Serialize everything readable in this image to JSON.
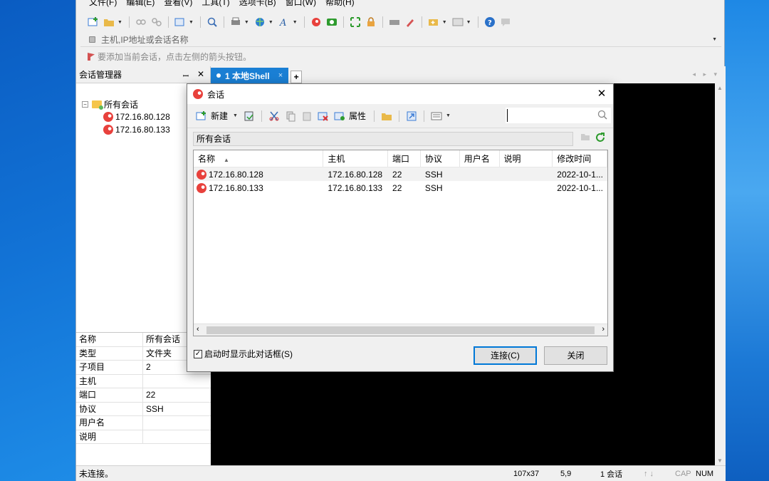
{
  "menu": [
    "文件(F)",
    "编辑(E)",
    "查看(V)",
    "工具(T)",
    "选项卡(B)",
    "窗口(W)",
    "帮助(H)"
  ],
  "address": {
    "placeholder": "主机,IP地址或会话名称"
  },
  "hint": "要添加当前会话，点击左侧的箭头按钮。",
  "session_manager": {
    "title": "会话管理器",
    "tree_root": "所有会话",
    "sessions": [
      "172.16.80.128",
      "172.16.80.133"
    ]
  },
  "properties": [
    {
      "k": "名称",
      "v": "所有会话"
    },
    {
      "k": "类型",
      "v": "文件夹"
    },
    {
      "k": "子项目",
      "v": "2"
    },
    {
      "k": "主机",
      "v": ""
    },
    {
      "k": "端口",
      "v": "22"
    },
    {
      "k": "协议",
      "v": "SSH"
    },
    {
      "k": "用户名",
      "v": ""
    },
    {
      "k": "说明",
      "v": ""
    }
  ],
  "tab": {
    "label": "1 本地Shell",
    "close": "×",
    "add": "+"
  },
  "status": {
    "left": "未连接。",
    "size": "107x37",
    "pos": "5,9",
    "sessions": "1 会话",
    "cap": "CAP",
    "num": "NUM"
  },
  "dialog": {
    "title": "会话",
    "close": "✕",
    "toolbar": {
      "new": "新建",
      "properties": "属性"
    },
    "path": "所有会话",
    "columns": [
      "名称",
      "主机",
      "端口",
      "协议",
      "用户名",
      "说明",
      "修改时间"
    ],
    "rows": [
      {
        "name": "172.16.80.128",
        "host": "172.16.80.128",
        "port": "22",
        "proto": "SSH",
        "user": "",
        "desc": "",
        "mtime": "2022-10-1..."
      },
      {
        "name": "172.16.80.133",
        "host": "172.16.80.133",
        "port": "22",
        "proto": "SSH",
        "user": "",
        "desc": "",
        "mtime": "2022-10-1..."
      }
    ],
    "startup_checkbox": "启动时显示此对话框(S)",
    "startup_checked": true,
    "connect": "连接(C)",
    "close_button": "关闭"
  },
  "colors": {
    "tab_active": "#1a7fd4",
    "session_icon": "#e8413c",
    "terminal_bg": "#000000"
  }
}
